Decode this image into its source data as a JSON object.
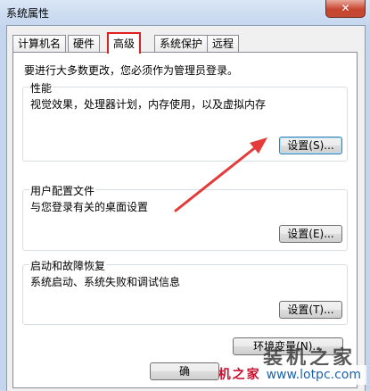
{
  "window": {
    "title": "系统属性",
    "close_glyph": "✕"
  },
  "tabs": [
    {
      "label": "计算机名",
      "active": false
    },
    {
      "label": "硬件",
      "active": false
    },
    {
      "label": "高级",
      "active": true
    },
    {
      "label": "系统保护",
      "active": false
    },
    {
      "label": "远程",
      "active": false
    }
  ],
  "advanced": {
    "intro": "要进行大多数更改，您必须作为管理员登录。",
    "performance": {
      "title": "性能",
      "description": "视觉效果，处理器计划，内存使用，以及虚拟内存",
      "button": "设置(S)..."
    },
    "user_profiles": {
      "title": "用户配置文件",
      "description": "与您登录有关的桌面设置",
      "button": "设置(E)..."
    },
    "startup_recovery": {
      "title": "启动和故障恢复",
      "description": "系统启动、系统失败和调试信息",
      "button": "设置(T)..."
    },
    "env_button": "环境变量(N)...",
    "ok_button": "确"
  },
  "watermark": {
    "big": "装机之家",
    "small_cn": "装机之家",
    "small_url": "www.lotpc.com"
  },
  "colors": {
    "highlight": "#e02020",
    "arrow": "#e53a3a"
  }
}
